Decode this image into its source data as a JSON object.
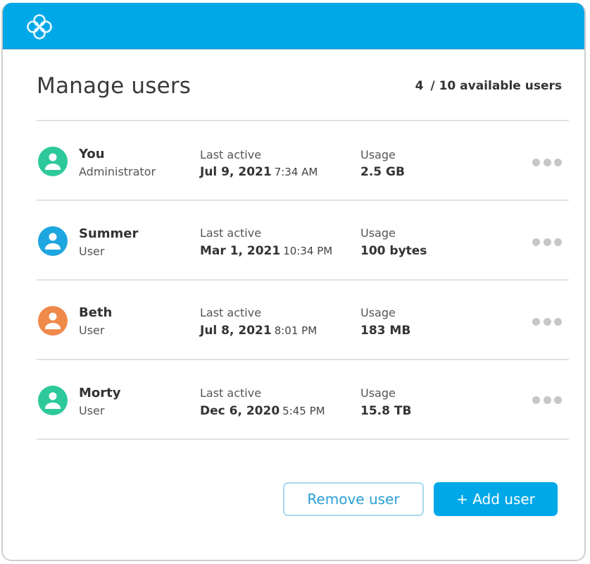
{
  "app": {
    "logo_icon": "four-circles-logo-icon",
    "accent_color": "#00a8e8"
  },
  "header": {
    "title": "Manage users",
    "available_count": "4",
    "available_text": "/ 10 available users"
  },
  "labels": {
    "last_active": "Last active",
    "usage": "Usage"
  },
  "users": [
    {
      "name": "You",
      "role": "Administrator",
      "date": "Jul 9, 2021",
      "time": "7:34 AM",
      "usage": "2.5 GB",
      "avatar_color": "#2ec99a",
      "more_icon": "more-horizontal-icon"
    },
    {
      "name": "Summer",
      "role": "User",
      "date": "Mar 1, 2021",
      "time": "10:34 PM",
      "usage": "100 bytes",
      "avatar_color": "#1ea6e0",
      "more_icon": "more-horizontal-icon"
    },
    {
      "name": "Beth",
      "role": "User",
      "date": "Jul 8, 2021",
      "time": "8:01 PM",
      "usage": "183 MB",
      "avatar_color": "#f08a4b",
      "more_icon": "more-horizontal-icon"
    },
    {
      "name": "Morty",
      "role": "User",
      "date": "Dec 6, 2020",
      "time": "5:45 PM",
      "usage": "15.8 TB",
      "avatar_color": "#2ec99a",
      "more_icon": "more-horizontal-icon"
    }
  ],
  "actions": {
    "remove_label": "Remove user",
    "add_label": "+ Add user"
  }
}
